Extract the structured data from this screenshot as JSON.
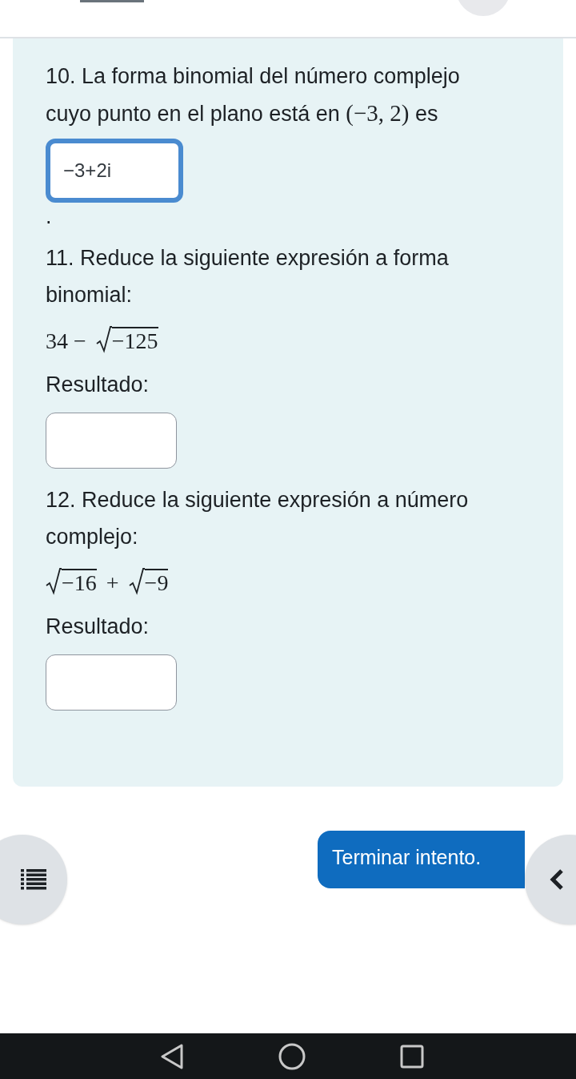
{
  "questions": [
    {
      "number": "10.",
      "text": "La forma binomial del número complejo cuyo punto en el plano está en",
      "inline_math": "(−3, 2)",
      "after": "es",
      "answer": {
        "value": "−3+2i",
        "focused": true
      },
      "trailing": "."
    },
    {
      "number": "11.",
      "text": "Reduce la siguiente expresión a forma binomial:",
      "math": [
        {
          "kind": "text",
          "text": "34 −"
        },
        {
          "kind": "sqrt",
          "text": "−125"
        }
      ],
      "result_label": "Resultado:",
      "answer": {
        "focused": false
      }
    },
    {
      "number": "12.",
      "text": "Reduce la siguiente expresión a número complejo:",
      "math": [
        {
          "kind": "sqrt",
          "text": "−16"
        },
        {
          "kind": "text",
          "text": "+"
        },
        {
          "kind": "sqrt",
          "text": "−9"
        }
      ],
      "result_label": "Resultado:",
      "answer": {
        "focused": false
      }
    }
  ],
  "finish_button": "Terminar intento."
}
